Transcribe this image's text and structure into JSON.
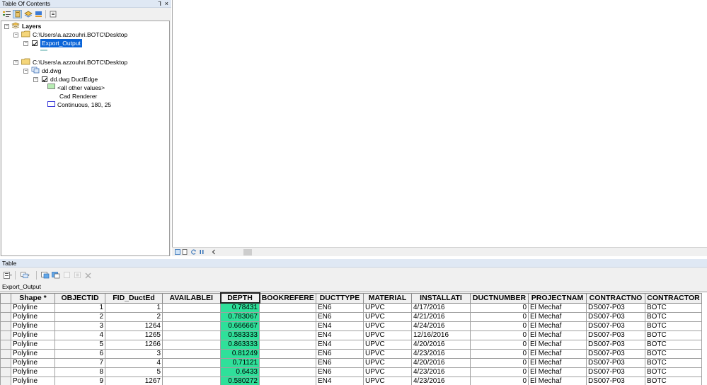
{
  "toc": {
    "title": "Table Of Contents",
    "pin_glyph": "⅂",
    "close_glyph": "×",
    "root_label": "Layers",
    "folder1_path": "C:\\Users\\a.azzouhri.BOTC\\Desktop",
    "layer1_name": "Export_Output",
    "folder2_path": "C:\\Users\\a.azzouhri.BOTC\\Desktop",
    "dwg_name": "dd.dwg",
    "sublayer_name": "dd.dwg DuctEdge",
    "legend_other": "<all other values>",
    "renderer_label": "Cad Renderer",
    "legend_line": "Continuous, 180, 25"
  },
  "table": {
    "title": "Table",
    "tab_label": "Export_Output",
    "columns": [
      "Shape *",
      "OBJECTID",
      "FID_DuctEd",
      "AVAILABLEI",
      "DEPTH",
      "BOOKREFERE",
      "DUCTTYPE",
      "MATERIAL",
      "INSTALLATI",
      "DUCTNUMBER",
      "PROJECTNAM",
      "CONTRACTNO",
      "CONTRACTOR"
    ],
    "rows": [
      [
        "Polyline",
        "1",
        "1",
        "",
        "0.78431",
        "",
        "EN6",
        "UPVC",
        "4/17/2016",
        "0",
        "El Mechaf",
        "DS007-P03",
        "BOTC"
      ],
      [
        "Polyline",
        "2",
        "2",
        "",
        "0.783067",
        "",
        "EN6",
        "UPVC",
        "4/21/2016",
        "0",
        "El Mechaf",
        "DS007-P03",
        "BOTC"
      ],
      [
        "Polyline",
        "3",
        "1264",
        "",
        "0.666667",
        "",
        "EN4",
        "UPVC",
        "4/24/2016",
        "0",
        "El Mechaf",
        "DS007-P03",
        "BOTC"
      ],
      [
        "Polyline",
        "4",
        "1265",
        "",
        "0.583333",
        "",
        "EN4",
        "UPVC",
        "12/16/2016",
        "0",
        "El Mechaf",
        "DS007-P03",
        "BOTC"
      ],
      [
        "Polyline",
        "5",
        "1266",
        "",
        "0.863333",
        "",
        "EN4",
        "UPVC",
        "4/20/2016",
        "0",
        "El Mechaf",
        "DS007-P03",
        "BOTC"
      ],
      [
        "Polyline",
        "6",
        "3",
        "",
        "0.81249",
        "",
        "EN6",
        "UPVC",
        "4/23/2016",
        "0",
        "El Mechaf",
        "DS007-P03",
        "BOTC"
      ],
      [
        "Polyline",
        "7",
        "4",
        "",
        "0.71121",
        "",
        "EN6",
        "UPVC",
        "4/20/2016",
        "0",
        "El Mechaf",
        "DS007-P03",
        "BOTC"
      ],
      [
        "Polyline",
        "8",
        "5",
        "",
        "0.6433",
        "",
        "EN6",
        "UPVC",
        "4/23/2016",
        "0",
        "El Mechaf",
        "DS007-P03",
        "BOTC"
      ],
      [
        "Polyline",
        "9",
        "1267",
        "",
        "0.580272",
        "",
        "EN4",
        "UPVC",
        "4/23/2016",
        "0",
        "El Mechaf",
        "DS007-P03",
        "BOTC"
      ]
    ]
  },
  "colors": {
    "depth_highlight": "#2fe09a",
    "selection": "#0a64d8",
    "title_bar": "#dfe8f4"
  },
  "icons": [
    "list-by-drawing-order-icon",
    "list-by-source-icon",
    "list-by-visibility-icon",
    "list-by-selection-icon",
    "options-icon",
    "table-options-icon",
    "related-tables-icon",
    "select-by-attributes-icon",
    "switch-selection-icon",
    "clear-selection-icon",
    "zoom-to-selected-icon",
    "delete-selected-icon",
    "data-view-icon",
    "layout-view-icon",
    "refresh-icon",
    "pause-icon",
    "scroll-left-icon"
  ]
}
